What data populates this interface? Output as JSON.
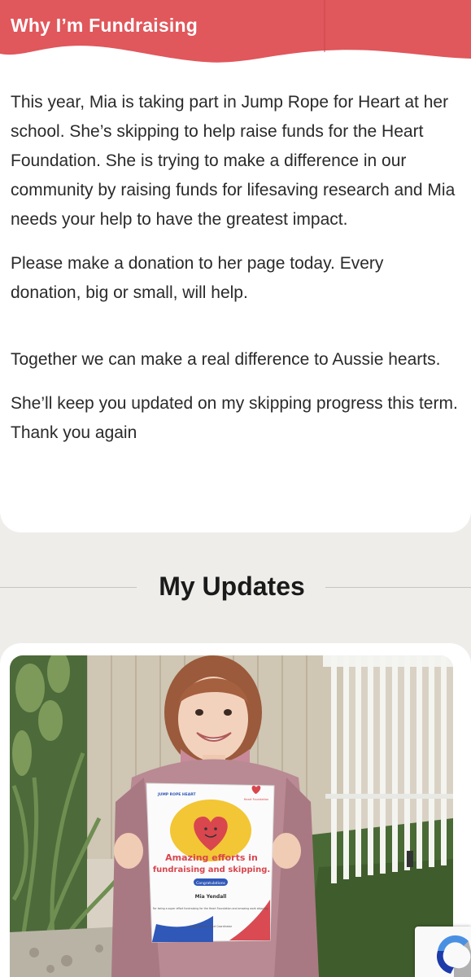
{
  "why": {
    "title": "Why I’m Fundraising",
    "paragraphs": [
      "This year, Mia is taking part in Jump Rope for Heart at her school. She’s skipping to help raise funds for the Heart Foundation. She is trying to make a difference in our community by raising funds for lifesaving research and Mia needs your help to have the greatest impact.",
      "Please make a donation to her page today. Every donation, big or small, will help.",
      "Together we can make a real difference to Aussie hearts.",
      "She’ll keep you updated on my skipping progress this term. Thank you again"
    ]
  },
  "updates": {
    "title": "My Updates"
  },
  "certificate": {
    "logo_left": "JUMP ROPE HEART",
    "logo_right": "Heart Foundation",
    "headline_line1": "Amazing efforts in",
    "headline_line2": "fundraising and skipping.",
    "pill": "Congratulations",
    "name": "Mia Yendall",
    "body": "For being a super effort fundraising for the Heart Foundation and amazing work skipping.",
    "footer": "Jump Rope for Heart Coordinator"
  },
  "colors": {
    "brand_red": "#e0575c",
    "page_bg": "#efedea",
    "text": "#2a2a2a"
  },
  "icons": {
    "recaptcha": "recaptcha-icon"
  }
}
